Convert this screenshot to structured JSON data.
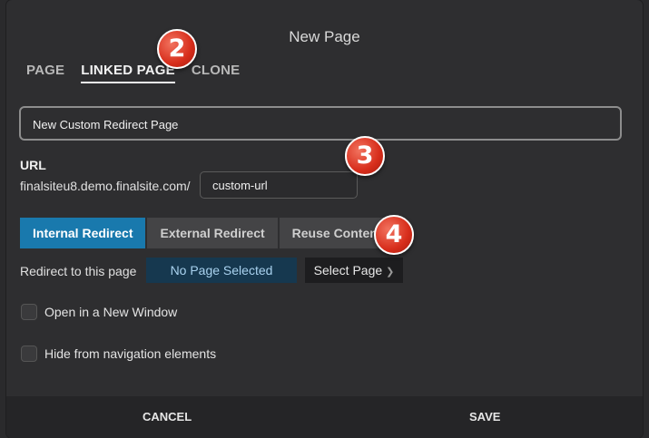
{
  "dialog": {
    "title": "New Page"
  },
  "tabs": [
    {
      "label": "PAGE"
    },
    {
      "label": "LINKED PAGE"
    },
    {
      "label": "CLONE"
    }
  ],
  "page_name": {
    "value": "New Custom Redirect Page"
  },
  "url": {
    "label": "URL",
    "prefix": "finalsiteu8.demo.finalsite.com/",
    "value": "custom-url"
  },
  "redirect_types": [
    {
      "label": "Internal Redirect",
      "active": true
    },
    {
      "label": "External Redirect",
      "active": false
    },
    {
      "label": "Reuse Content",
      "active": false
    }
  ],
  "redirect": {
    "label": "Redirect to this page",
    "selected": "No Page Selected",
    "select_button": "Select Page"
  },
  "options": [
    {
      "label": "Open in a New Window",
      "checked": false
    },
    {
      "label": "Hide from navigation elements",
      "checked": false
    }
  ],
  "footer": {
    "cancel": "CANCEL",
    "save": "SAVE"
  },
  "markers": [
    "2",
    "3",
    "4"
  ],
  "colors": {
    "accent": "#1979ad",
    "marker": "#d72d1b"
  }
}
